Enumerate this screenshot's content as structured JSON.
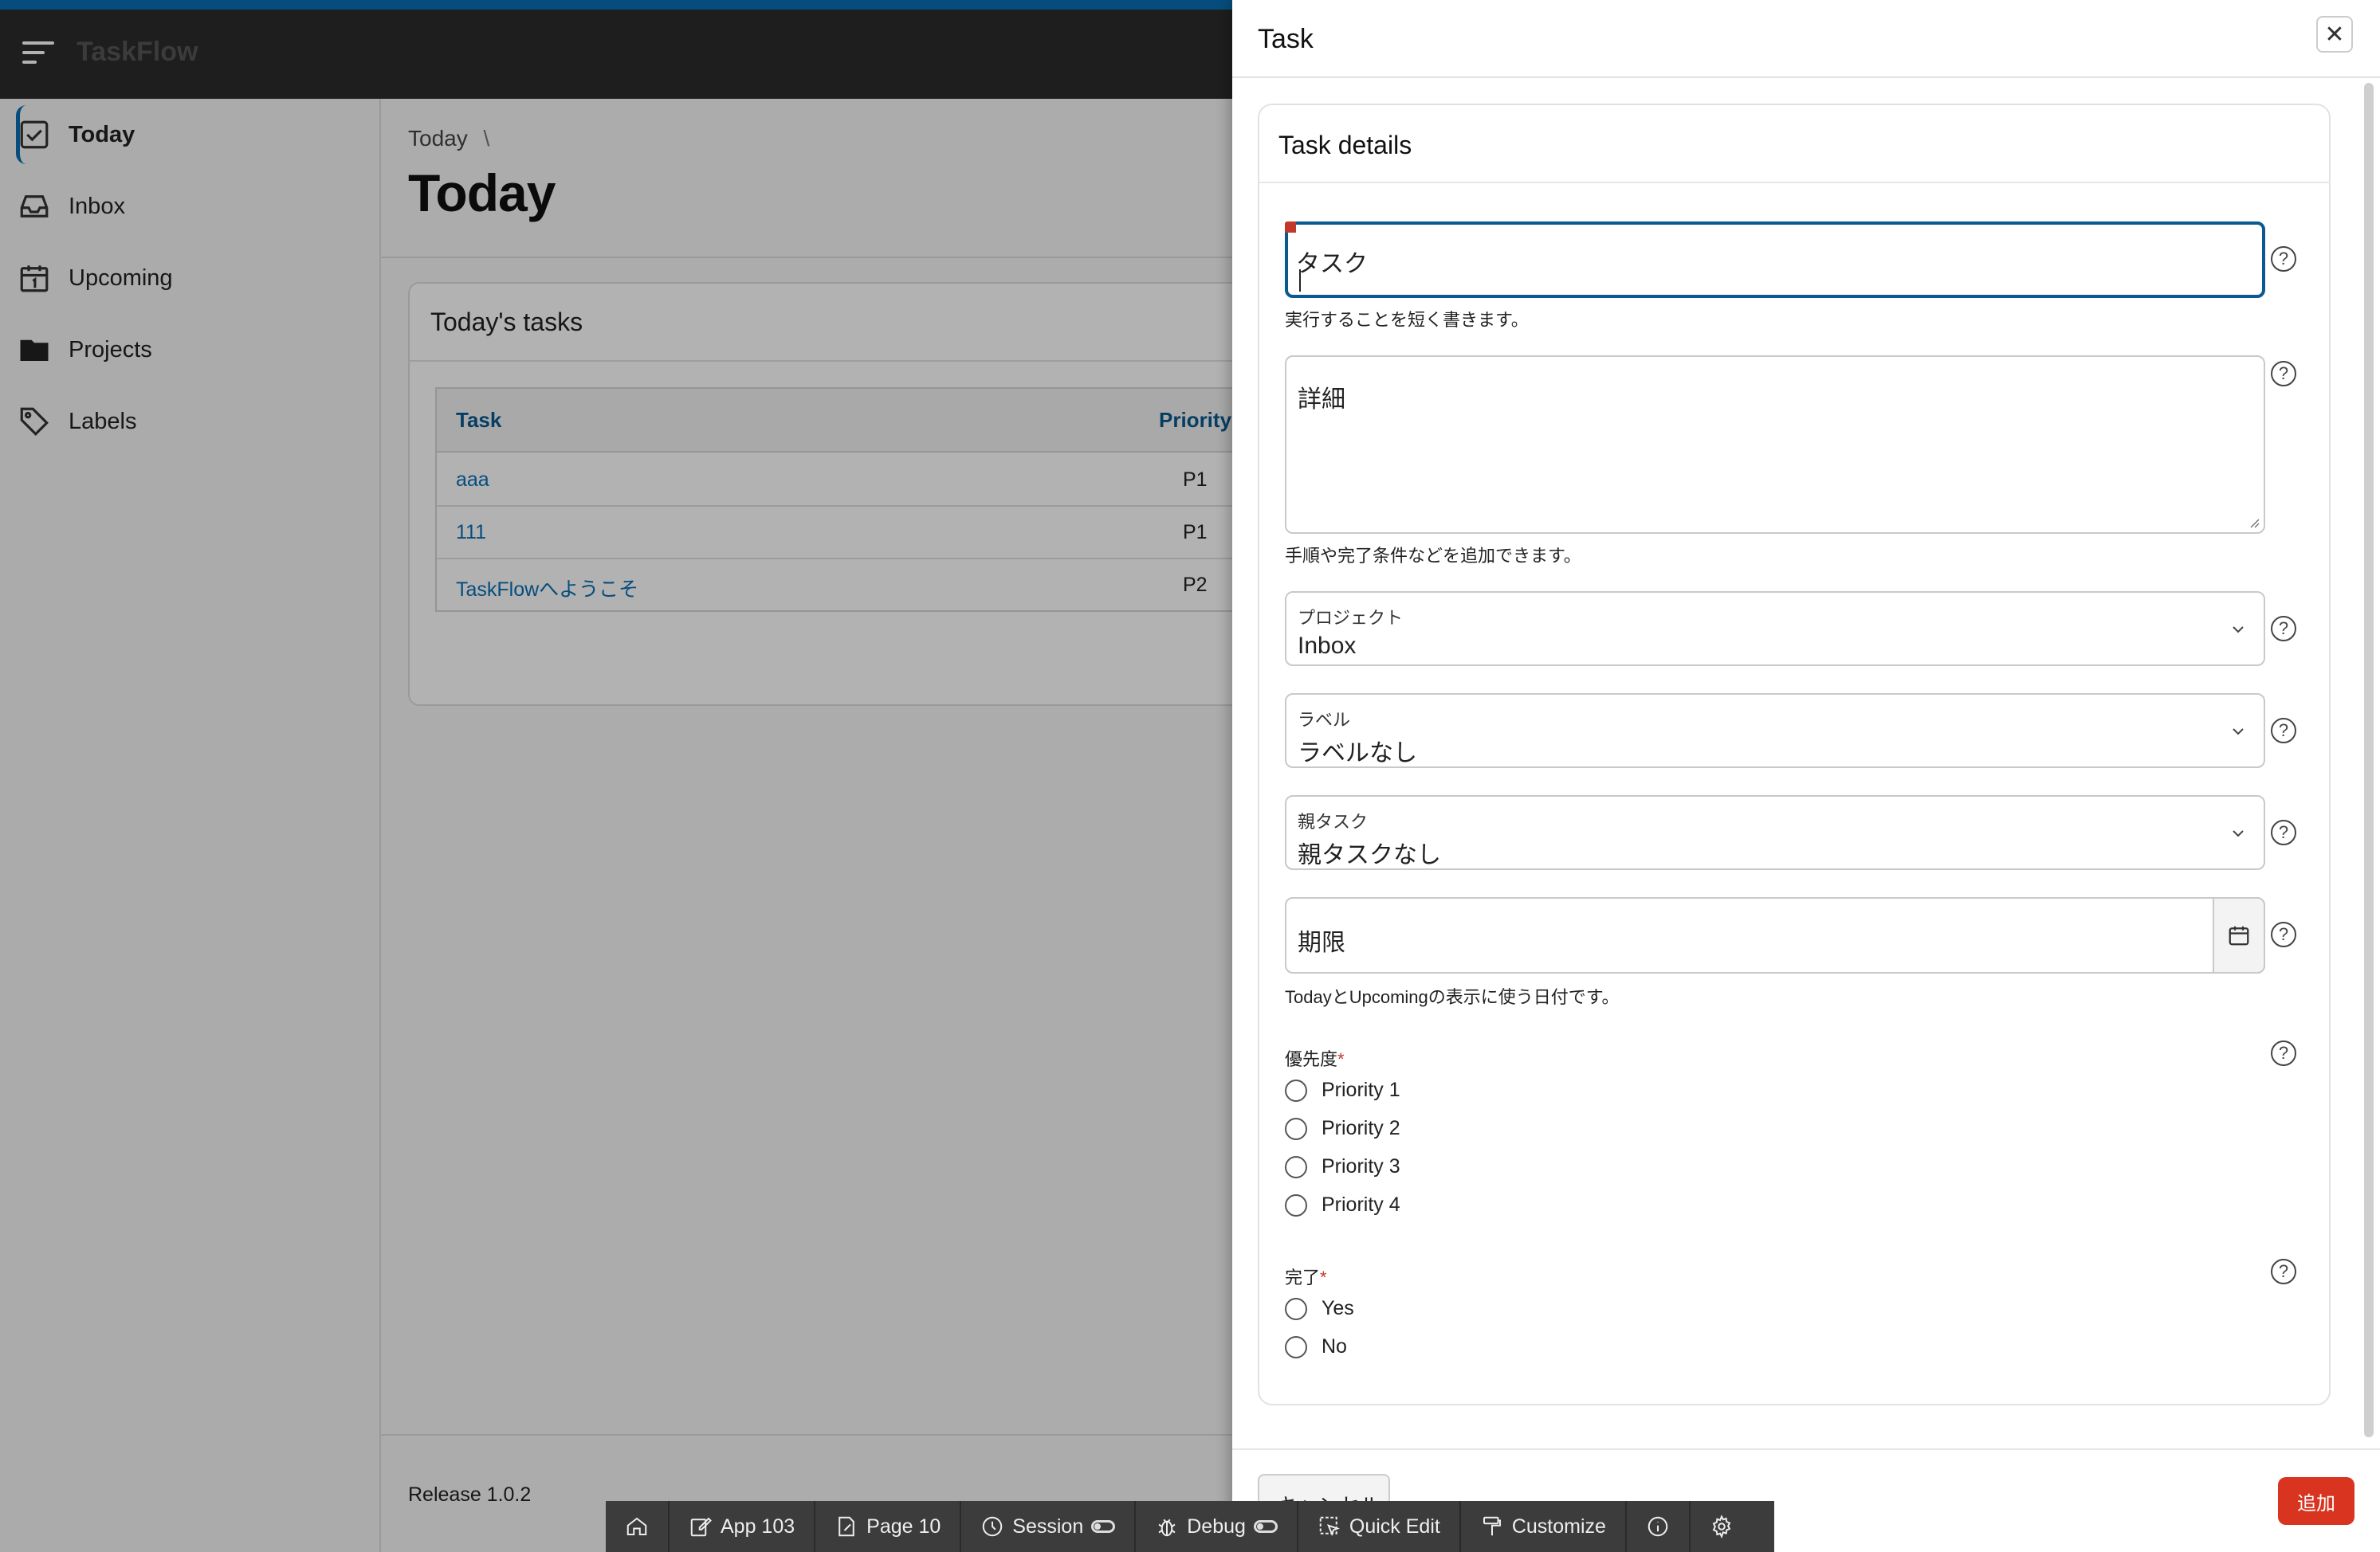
{
  "app": {
    "name": "TaskFlow"
  },
  "sidebar": {
    "items": [
      {
        "label": "Today",
        "icon": "check-square-icon",
        "active": true
      },
      {
        "label": "Inbox",
        "icon": "inbox-icon"
      },
      {
        "label": "Upcoming",
        "icon": "calendar-icon"
      },
      {
        "label": "Projects",
        "icon": "folder-icon"
      },
      {
        "label": "Labels",
        "icon": "tag-icon"
      }
    ]
  },
  "page": {
    "breadcrumb": "Today",
    "breadcrumb_sep": "\\",
    "title": "Today",
    "release": "Release 1.0.2"
  },
  "tasks_card": {
    "title": "Today's tasks",
    "columns": [
      "Task",
      "Priority"
    ],
    "rows": [
      {
        "task": "aaa",
        "priority": "P1"
      },
      {
        "task": "111",
        "priority": "P1"
      },
      {
        "task": "TaskFlowへようこそ",
        "priority": "P2"
      }
    ]
  },
  "drawer": {
    "title": "Task",
    "close_icon": "close-icon",
    "section_title": "Task details",
    "task_field": {
      "value": "タスク",
      "hint": "実行することを短く書きます。"
    },
    "details_field": {
      "value": "詳細",
      "hint": "手順や完了条件などを追加できます。"
    },
    "project_select": {
      "label": "プロジェクト",
      "value": "Inbox"
    },
    "label_select": {
      "label": "ラベル",
      "value": "ラベルなし"
    },
    "parent_select": {
      "label": "親タスク",
      "value": "親タスクなし"
    },
    "due_field": {
      "value": "期限",
      "hint": "TodayとUpcomingの表示に使う日付です。"
    },
    "priority": {
      "label": "優先度",
      "required_mark": "*",
      "options": [
        "Priority 1",
        "Priority 2",
        "Priority 3",
        "Priority 4"
      ]
    },
    "done": {
      "label": "完了",
      "required_mark": "*",
      "options": [
        "Yes",
        "No"
      ]
    },
    "cancel_label": "キャンセル",
    "add_label": "追加"
  },
  "devbar": {
    "home_icon": "home-icon",
    "app": "App 103",
    "page": "Page 10",
    "session": "Session",
    "debug": "Debug",
    "quick_edit": "Quick Edit",
    "customize": "Customize"
  },
  "colors": {
    "accent": "#0a6fb3",
    "header_bg": "#2b2b2b",
    "add_button": "#d9341f"
  }
}
